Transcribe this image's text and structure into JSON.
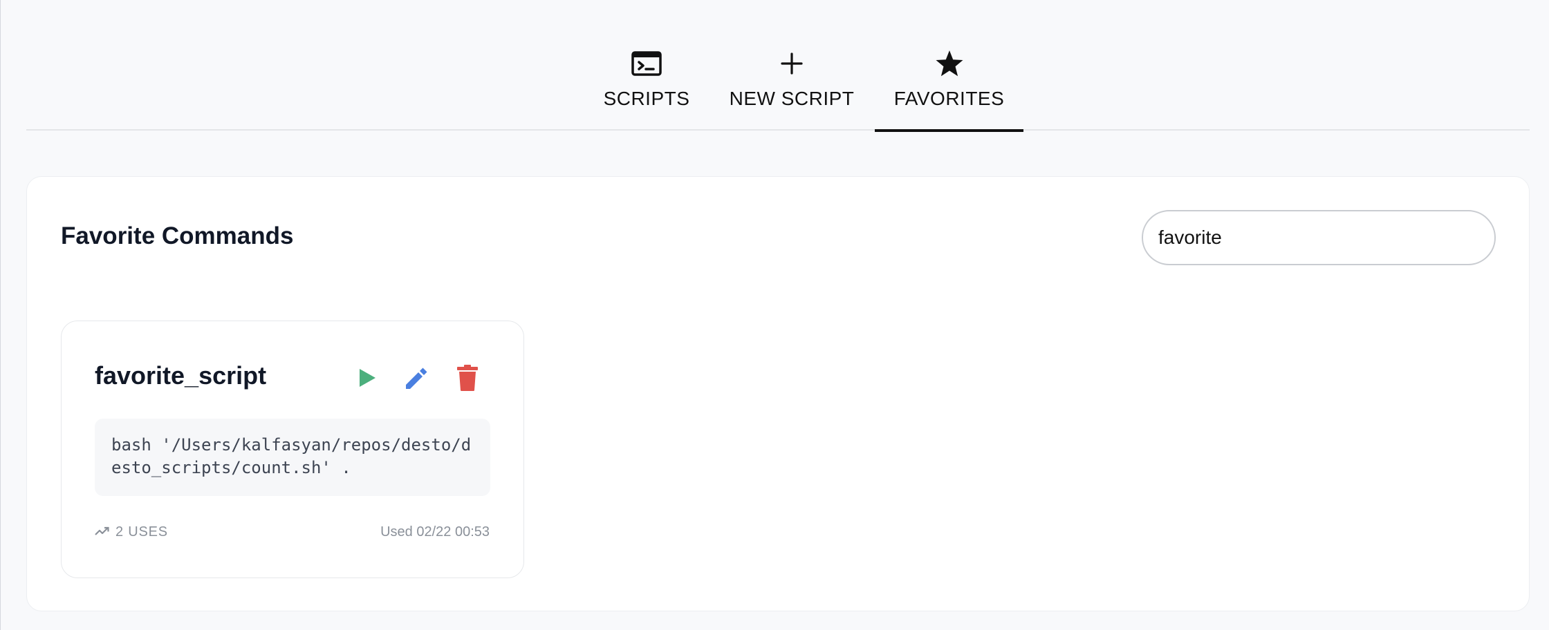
{
  "tabs": [
    {
      "label": "SCRIPTS",
      "icon": "terminal-icon",
      "active": false
    },
    {
      "label": "NEW SCRIPT",
      "icon": "plus-icon",
      "active": false
    },
    {
      "label": "FAVORITES",
      "icon": "star-icon",
      "active": true
    }
  ],
  "panel": {
    "title": "Favorite Commands",
    "search": {
      "value": "favorite",
      "placeholder": ""
    }
  },
  "card": {
    "name": "favorite_script",
    "command": "bash '/Users/kalfasyan/repos/desto/desto_scripts/count.sh' .",
    "uses": "2 USES",
    "last_used": "Used 02/22 00:53",
    "actions": {
      "run_icon": "play-icon",
      "edit_icon": "pencil-icon",
      "delete_icon": "trash-icon"
    }
  },
  "colors": {
    "run": "#4caf7d",
    "edit": "#4a7fe0",
    "delete": "#e0514a",
    "active_tab_underline": "#111111"
  }
}
